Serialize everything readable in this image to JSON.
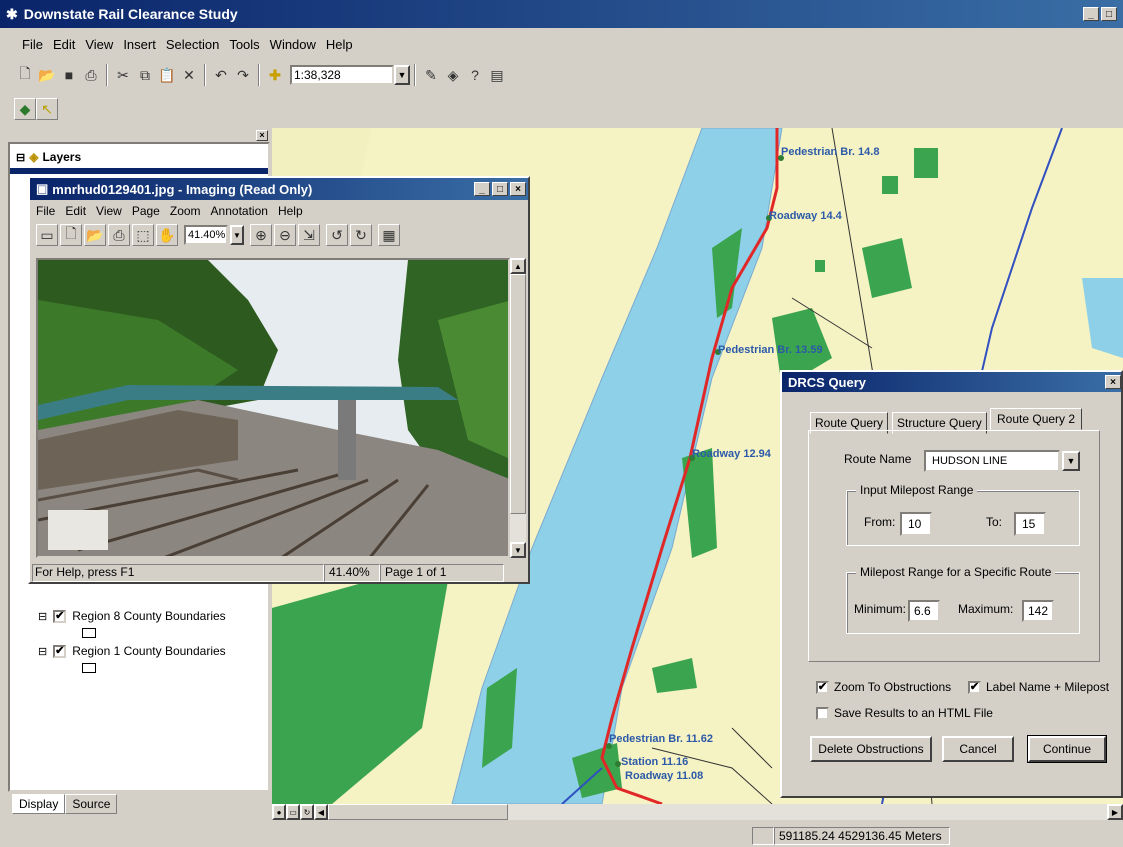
{
  "app": {
    "title": "Downstate Rail Clearance Study",
    "menu": [
      "File",
      "Edit",
      "View",
      "Insert",
      "Selection",
      "Tools",
      "Window",
      "Help"
    ],
    "scale": "1:38,328"
  },
  "toc": {
    "root_label": "Layers",
    "layers": [
      "Region 8 County Boundaries",
      "Region 1 County Boundaries"
    ],
    "tabs": [
      "Display",
      "Source"
    ]
  },
  "imaging": {
    "title": "mnrhud0129401.jpg - Imaging (Read Only)",
    "menu": [
      "File",
      "Edit",
      "View",
      "Page",
      "Zoom",
      "Annotation",
      "Help"
    ],
    "zoom": "41.40%",
    "status_help": "For Help, press F1",
    "status_zoom": "41.40%",
    "status_page": "Page 1 of 1"
  },
  "map": {
    "labels": [
      "Pedestrian Br. 14.8",
      "Roadway 14.4",
      "Pedestrian Br. 13.59",
      "Roadway 12.94",
      "Pedestrian Br. 11.62",
      "Station 11.16",
      "Roadway 11.08"
    ]
  },
  "dialog": {
    "title": "DRCS Query",
    "tabs": [
      "Route Query",
      "Structure Query",
      "Route Query 2"
    ],
    "route_name_label": "Route Name",
    "route_name_value": "HUDSON LINE",
    "input_range_title": "Input Milepost Range",
    "from_label": "From:",
    "from_value": "10",
    "to_label": "To:",
    "to_value": "15",
    "specific_range_title": "Milepost Range for a Specific Route",
    "min_label": "Minimum:",
    "min_value": "6.6",
    "max_label": "Maximum:",
    "max_value": "142",
    "zoom_obstructions": "Zoom To Obstructions",
    "label_name_milepost": "Label Name + Milepost",
    "save_html": "Save Results to an HTML File",
    "delete_btn": "Delete Obstructions",
    "cancel_btn": "Cancel",
    "continue_btn": "Continue"
  },
  "status": {
    "coords": "591185.24  4529136.45 Meters"
  }
}
